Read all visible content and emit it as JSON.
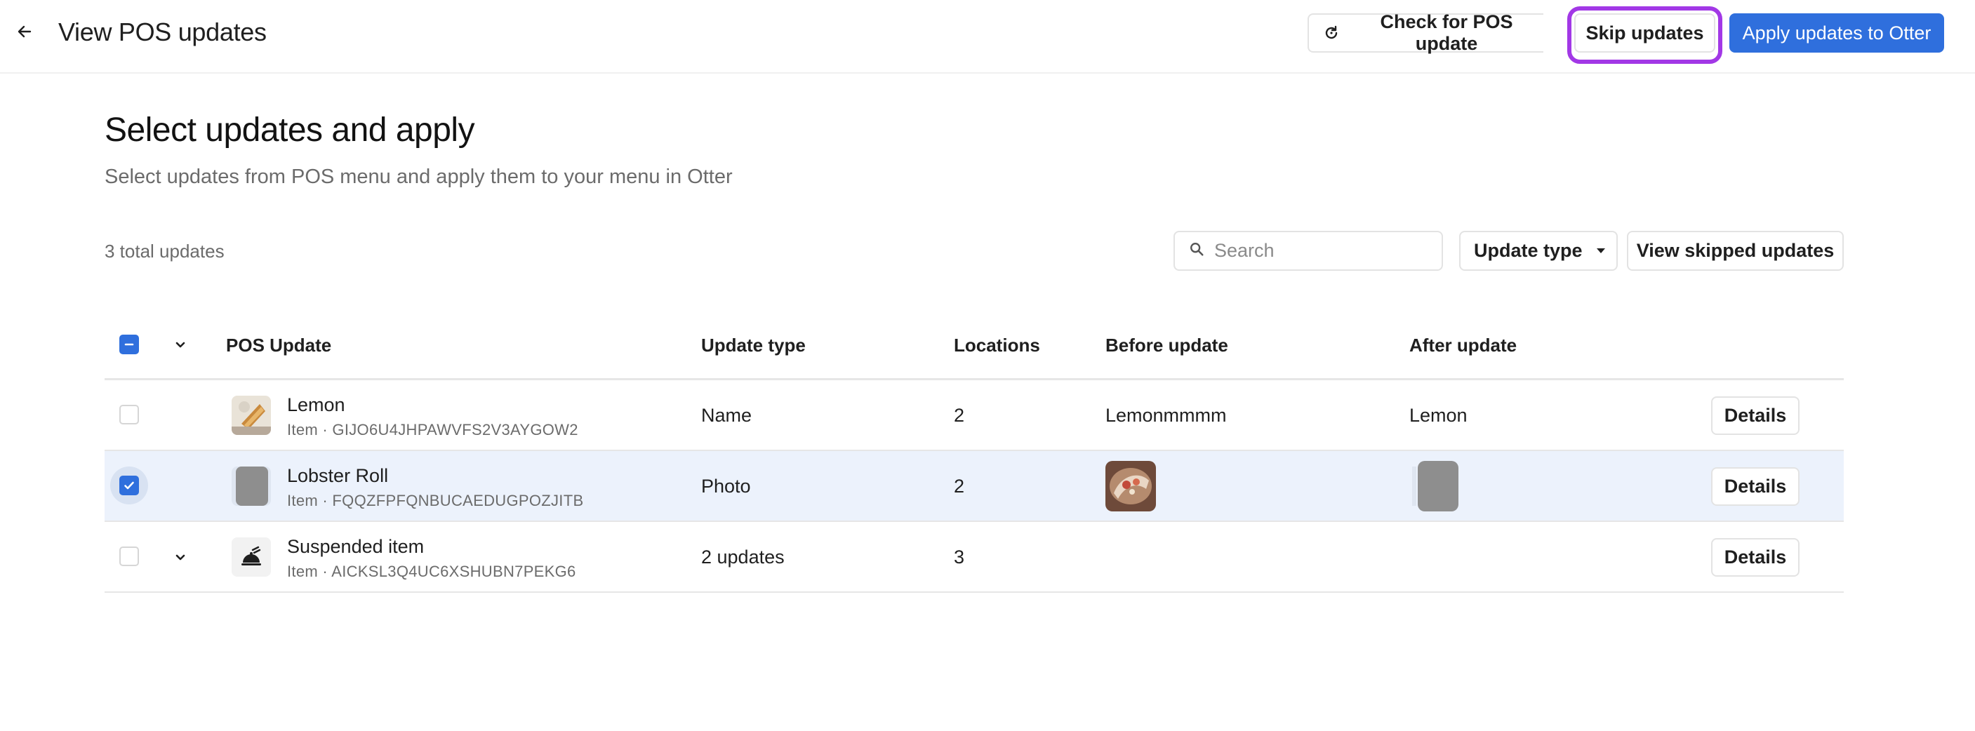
{
  "header": {
    "title": "View POS updates",
    "check_label": "Check for POS update",
    "skip_label": "Skip updates",
    "apply_label": "Apply updates to Otter"
  },
  "section": {
    "title": "Select updates and apply",
    "subtitle": "Select updates from POS menu and apply them to your menu in Otter"
  },
  "toolbar": {
    "total": "3 total updates",
    "search_placeholder": "Search",
    "update_type_label": "Update type",
    "view_skipped_label": "View skipped updates"
  },
  "table": {
    "columns": {
      "pos_update": "POS Update",
      "update_type": "Update type",
      "locations": "Locations",
      "before": "Before update",
      "after": "After update"
    },
    "rows": [
      {
        "name": "Lemon",
        "sub": "Item · GIJO6U4JHPAWVFS2V3AYGOW2",
        "update_type": "Name",
        "locations": "2",
        "before": "Lemonmmmm",
        "after": "Lemon",
        "details": "Details",
        "checked": false
      },
      {
        "name": "Lobster Roll",
        "sub": "Item · FQQZFPFQNBUCAEDUGPOZJITB",
        "update_type": "Photo",
        "locations": "2",
        "before": "",
        "after": "",
        "details": "Details",
        "checked": true
      },
      {
        "name": "Suspended item",
        "sub": "Item · AICKSL3Q4UC6XSHUBN7PEKG6",
        "update_type": "2 updates",
        "locations": "3",
        "before": "",
        "after": "",
        "details": "Details",
        "checked": false
      }
    ]
  },
  "colors": {
    "accent": "#2f6fdd",
    "highlight": "#a238e6",
    "selected_row": "#ecf2fc"
  }
}
